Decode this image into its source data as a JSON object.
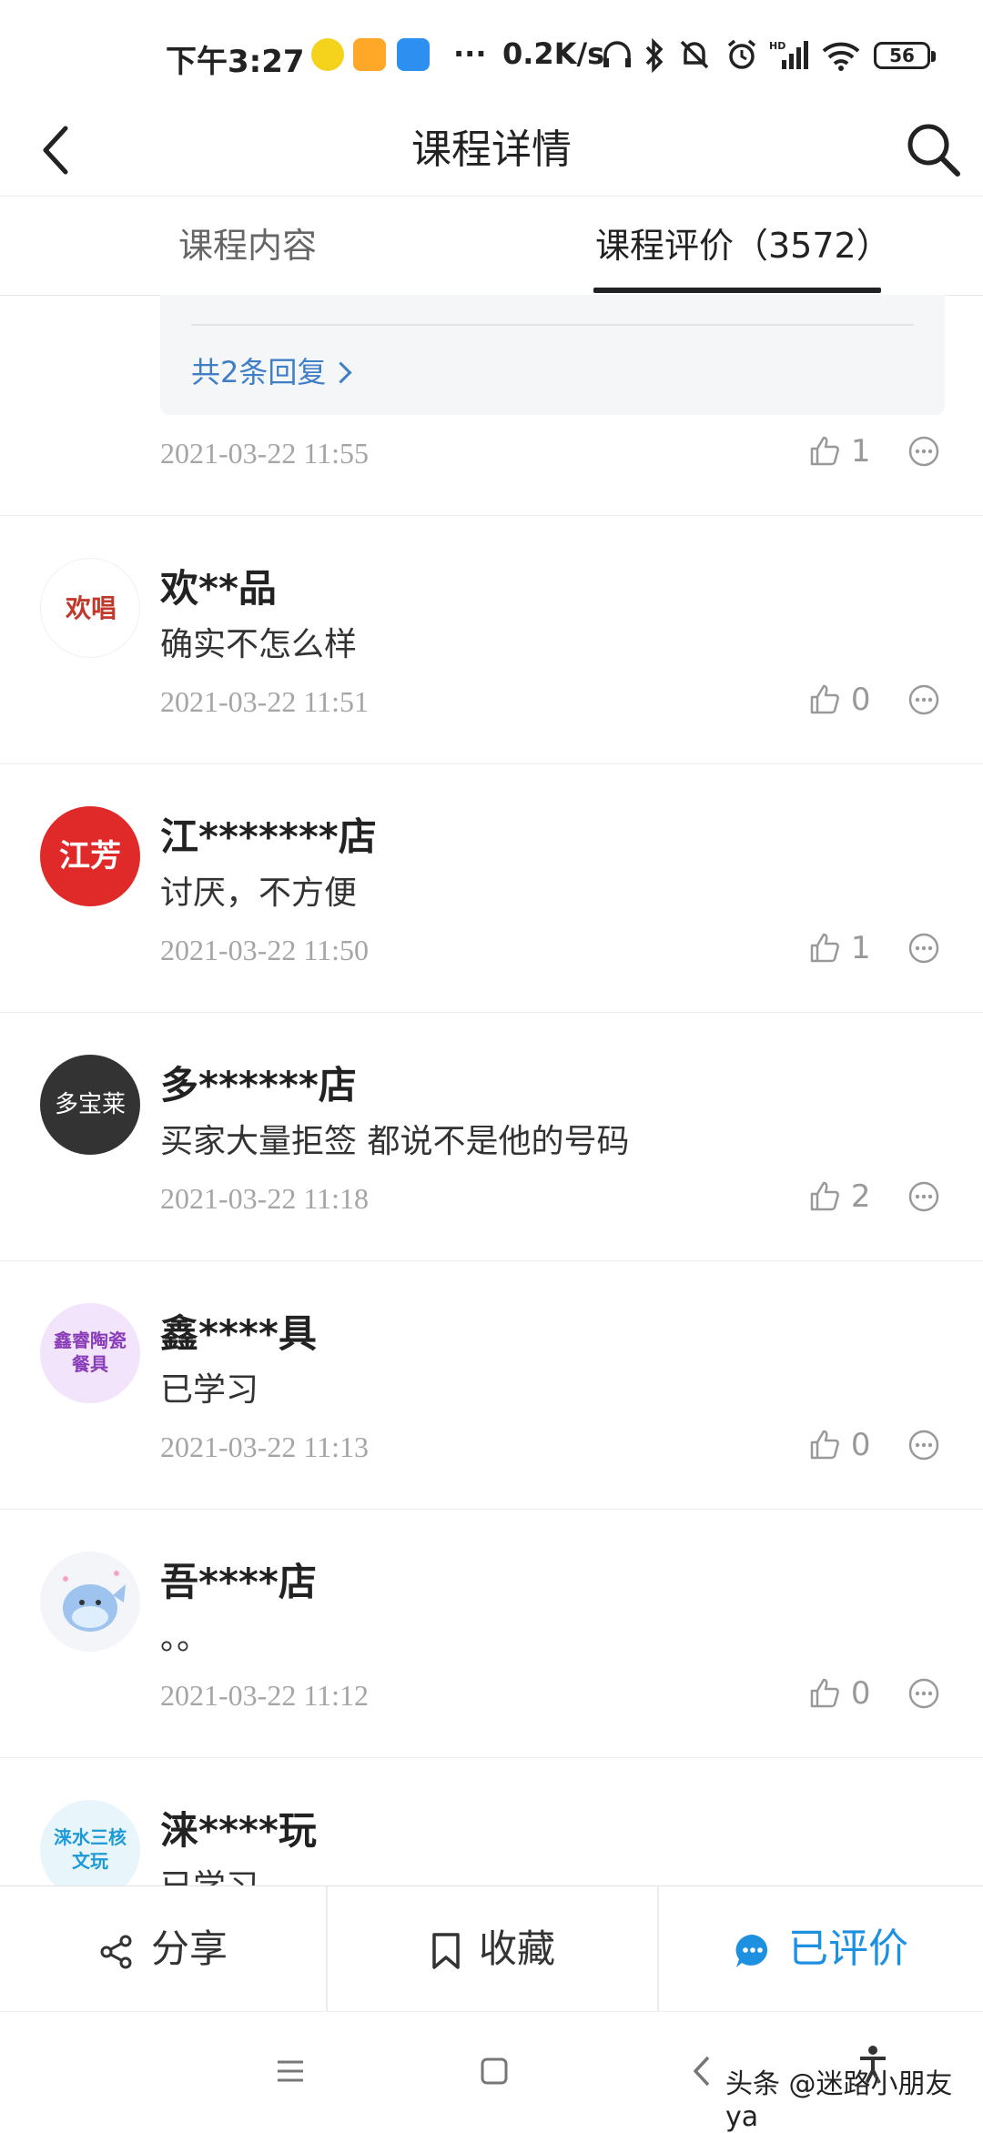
{
  "status_bar": {
    "time": "下午3:27",
    "net_speed": "0.2K/s",
    "dots": "···",
    "battery": "56"
  },
  "header": {
    "title": "课程详情",
    "back_icon": "chevron-left-icon",
    "search_icon": "search-icon"
  },
  "tabs": [
    {
      "label": "课程内容",
      "active": false
    },
    {
      "label": "课程评价（3572）",
      "active": true
    }
  ],
  "reply_box": {
    "link_text": "共2条回复"
  },
  "first_comment": {
    "date": "2021-03-22 11:55",
    "likes": "1"
  },
  "comments": [
    {
      "author": "欢**品",
      "content": "确实不怎么样",
      "date": "2021-03-22 11:51",
      "likes": "0",
      "avatar_text": "欢唱",
      "avatar_bg": "#ffffff",
      "avatar_color": "#c0392b"
    },
    {
      "author": "江*******店",
      "content": "讨厌，不方便",
      "date": "2021-03-22 11:50",
      "likes": "1",
      "avatar_text": "江芳",
      "avatar_bg": "#e02a2a",
      "avatar_color": "#ffffff"
    },
    {
      "author": "多******店",
      "content": "买家大量拒签 都说不是他的号码",
      "date": "2021-03-22 11:18",
      "likes": "2",
      "avatar_text": "多宝莱",
      "avatar_bg": "#333333",
      "avatar_color": "#ffffff"
    },
    {
      "author": "鑫****具",
      "content": "已学习",
      "date": "2021-03-22 11:13",
      "likes": "0",
      "avatar_text": "鑫睿陶瓷餐具",
      "avatar_bg": "#f1e4fb",
      "avatar_color": "#8a3db8"
    },
    {
      "author": "吾****店",
      "content": "。。",
      "date": "2021-03-22 11:12",
      "likes": "0",
      "avatar_text": "",
      "avatar_bg": "#e9f1fb",
      "avatar_color": "#5b8fd6"
    },
    {
      "author": "涞****玩",
      "content": "已学习",
      "date": "",
      "likes": "",
      "avatar_text": "涞水三核文玩",
      "avatar_bg": "#e8f6fc",
      "avatar_color": "#1d9ad6"
    }
  ],
  "bottom_actions": {
    "share": "分享",
    "favorite": "收藏",
    "reviewed": "已评价"
  },
  "colors": {
    "accent": "#1e90e0",
    "link": "#3f7fc6",
    "muted": "#a5a5a5"
  },
  "watermark": "头条 @迷路小朋友ya"
}
